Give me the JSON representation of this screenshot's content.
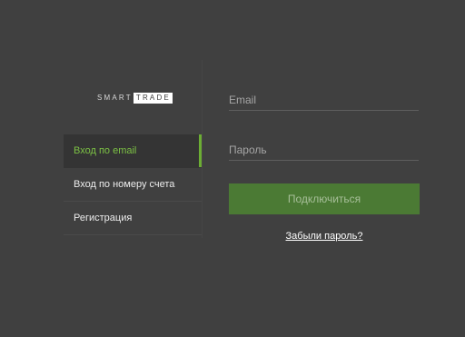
{
  "brand": {
    "logo_part1": "SMART",
    "logo_part2": "TRADE"
  },
  "nav": {
    "items": [
      {
        "label": "Вход по email",
        "active": true
      },
      {
        "label": "Вход по номеру счета",
        "active": false
      },
      {
        "label": "Регистрация",
        "active": false
      }
    ]
  },
  "form": {
    "email_placeholder": "Email",
    "email_value": "",
    "password_placeholder": "Пароль",
    "password_value": "",
    "submit_label": "Подключиться",
    "forgot_label": "Забыли пароль?"
  },
  "colors": {
    "background": "#404040",
    "accent": "#7cc144",
    "button": "#4b7a34"
  }
}
